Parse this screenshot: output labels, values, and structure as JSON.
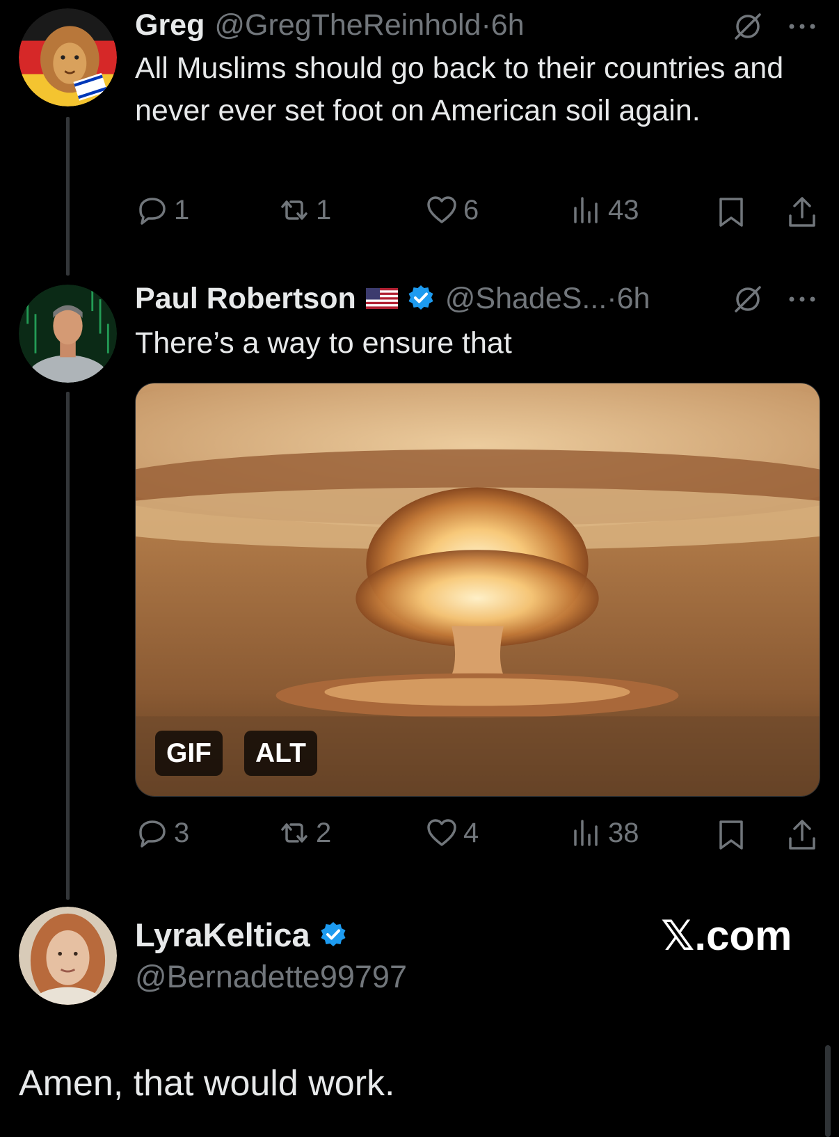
{
  "tweets": [
    {
      "name": "Greg",
      "handle": "@GregTheReinhold",
      "separator": "·",
      "time": "6h",
      "text": "All Muslims should go back to their countries and never ever set foot on American soil again.",
      "actions": {
        "replies": "1",
        "reposts": "1",
        "likes": "6",
        "views": "43"
      }
    },
    {
      "name": "Paul Robertson",
      "handle": "@ShadeS...",
      "separator": "·",
      "time": "6h",
      "text": "There’s a way to ensure that",
      "media": {
        "gif_label": "GIF",
        "alt_label": "ALT"
      },
      "actions": {
        "replies": "3",
        "reposts": "2",
        "likes": "4",
        "views": "38"
      }
    }
  ],
  "quote": {
    "name": "LyraKeltica",
    "handle": "@Bernadette99797",
    "text": "Amen, that would work."
  },
  "watermark": "𝕏.com",
  "colors": {
    "background": "#000000",
    "text": "#e7e9ea",
    "muted": "#71767b",
    "verified": "#1d9bf0"
  },
  "icons": [
    "grok-icon",
    "more-icon",
    "reply-icon",
    "repost-icon",
    "like-icon",
    "views-icon",
    "bookmark-icon",
    "share-icon",
    "verified-badge-icon",
    "us-flag-icon"
  ]
}
